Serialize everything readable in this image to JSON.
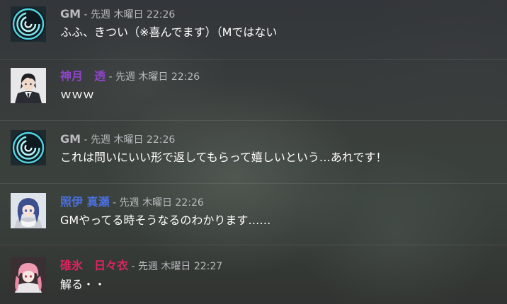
{
  "messages": [
    {
      "author": "GM",
      "author_color": "#b9bbbe",
      "separator": " - ",
      "timestamp": "先週 木曜日 22:26",
      "text": "ふふ、きつい（※喜んでます）（Mではない",
      "avatar_icon": "gm-spiral-icon"
    },
    {
      "author": "神月　透",
      "author_color": "#8e44c9",
      "separator": " - ",
      "timestamp": "先週 木曜日 22:26",
      "text": "ｗｗｗ",
      "avatar_icon": "character-portrait-icon"
    },
    {
      "author": "GM",
      "author_color": "#b9bbbe",
      "separator": " - ",
      "timestamp": "先週 木曜日 22:26",
      "text": "これは問いにいい形で返してもらって嬉しいという…あれです！",
      "avatar_icon": "gm-spiral-icon"
    },
    {
      "author": "照伊 真瀬",
      "author_color": "#4b6fe0",
      "separator": " - ",
      "timestamp": "先週 木曜日 22:26",
      "text": "GMやってる時そうなるのわかります……",
      "avatar_icon": "character-portrait-icon"
    },
    {
      "author": "碓氷　日々衣",
      "author_color": "#e0245e",
      "separator": " - ",
      "timestamp": "先週 木曜日 22:27",
      "text": "解る・・",
      "avatar_icon": "character-portrait-icon"
    }
  ]
}
